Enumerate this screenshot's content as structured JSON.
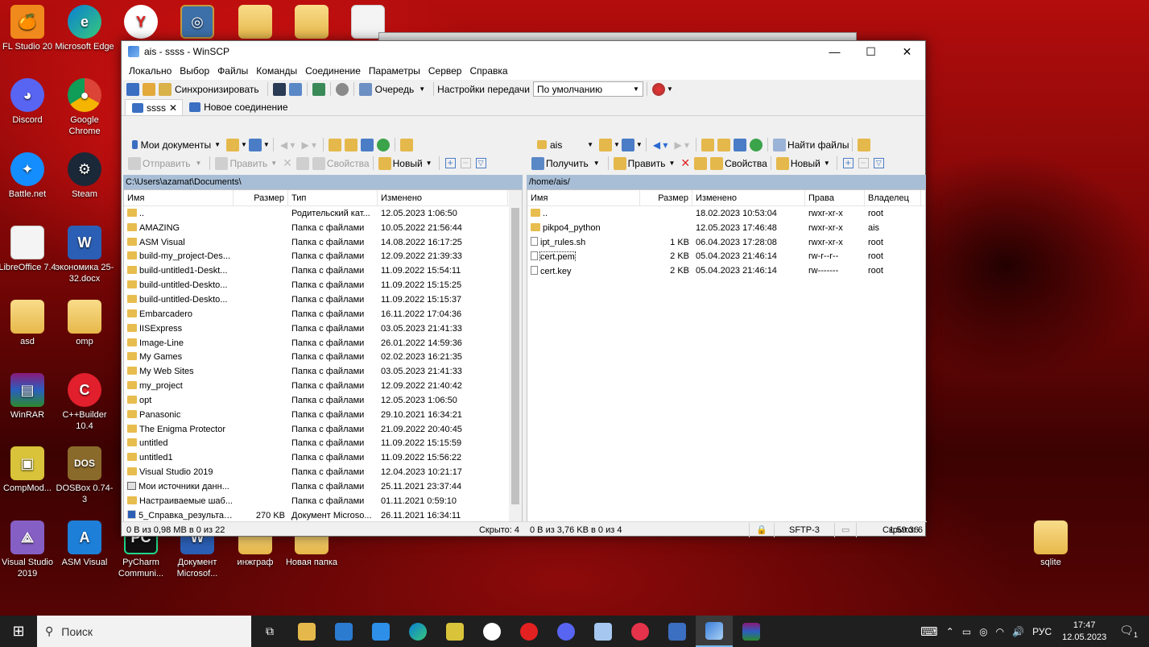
{
  "desktop": {
    "icons": [
      {
        "label": "FL Studio 20",
        "kind": "fl"
      },
      {
        "label": "Microsoft Edge",
        "kind": "edge"
      },
      {
        "label": "Discord",
        "kind": "discord"
      },
      {
        "label": "Google Chrome",
        "kind": "chrome"
      },
      {
        "label": "Battle.net",
        "kind": "battle"
      },
      {
        "label": "Steam",
        "kind": "steam"
      },
      {
        "label": "LibreOffice 7.4",
        "kind": "doc"
      },
      {
        "label": "экономика 25-32.docx",
        "kind": "word"
      },
      {
        "label": "asd",
        "kind": "folder"
      },
      {
        "label": "omp",
        "kind": "folder"
      },
      {
        "label": "WinRAR",
        "kind": "winrar"
      },
      {
        "label": "C++Builder 10.4",
        "kind": "cpp"
      },
      {
        "label": "CompMod...",
        "kind": "comp"
      },
      {
        "label": "DOSBox 0.74-3",
        "kind": "dosbox"
      },
      {
        "label": "Visual Studio 2019",
        "kind": "vs"
      },
      {
        "label": "ASM Visual",
        "kind": "asm"
      },
      {
        "label": "PyCharm Communi...",
        "kind": "pycharm"
      },
      {
        "label": "Документ Microsof...",
        "kind": "word"
      },
      {
        "label": "инжграф",
        "kind": "folder"
      },
      {
        "label": "Новая папка",
        "kind": "folder"
      },
      {
        "label": "sqlite",
        "kind": "folder"
      }
    ]
  },
  "window": {
    "title": "ais - ssss - WinSCP",
    "controls": {
      "minimize": "—",
      "maximize": "☐",
      "close": "✕"
    },
    "menu": [
      "Локально",
      "Выбор",
      "Файлы",
      "Команды",
      "Соединение",
      "Параметры",
      "Сервер",
      "Справка"
    ],
    "toolbar": {
      "sync": "Синхронизировать",
      "queue": "Очередь",
      "transfer_label": "Настройки передачи",
      "transfer_value": "По умолчанию"
    },
    "tabs": [
      {
        "label": "ssss",
        "close": "✕"
      },
      {
        "label": "Новое соединение"
      }
    ]
  },
  "left": {
    "location": "Мои документы",
    "actions": {
      "send": "Отправить",
      "edit": "Править",
      "props": "Свойства",
      "new": "Новый"
    },
    "path": "C:\\Users\\azamat\\Documents\\",
    "columns": [
      "Имя",
      "Размер",
      "Тип",
      "Изменено"
    ],
    "rows": [
      {
        "name": "..",
        "size": "",
        "type": "Родительский кат...",
        "mod": "12.05.2023  1:06:50",
        "icon": "up"
      },
      {
        "name": "AMAZING",
        "size": "",
        "type": "Папка с файлами",
        "mod": "10.05.2022  21:56:44",
        "icon": "dir"
      },
      {
        "name": "ASM Visual",
        "size": "",
        "type": "Папка с файлами",
        "mod": "14.08.2022  16:17:25",
        "icon": "dir"
      },
      {
        "name": "build-my_project-Des...",
        "size": "",
        "type": "Папка с файлами",
        "mod": "12.09.2022  21:39:33",
        "icon": "dir"
      },
      {
        "name": "build-untitled1-Deskt...",
        "size": "",
        "type": "Папка с файлами",
        "mod": "11.09.2022  15:54:11",
        "icon": "dir"
      },
      {
        "name": "build-untitled-Deskto...",
        "size": "",
        "type": "Папка с файлами",
        "mod": "11.09.2022  15:15:25",
        "icon": "dir"
      },
      {
        "name": "build-untitled-Deskto...",
        "size": "",
        "type": "Папка с файлами",
        "mod": "11.09.2022  15:15:37",
        "icon": "dir"
      },
      {
        "name": "Embarcadero",
        "size": "",
        "type": "Папка с файлами",
        "mod": "16.11.2022  17:04:36",
        "icon": "dir"
      },
      {
        "name": "IISExpress",
        "size": "",
        "type": "Папка с файлами",
        "mod": "03.05.2023  21:41:33",
        "icon": "dir"
      },
      {
        "name": "Image-Line",
        "size": "",
        "type": "Папка с файлами",
        "mod": "26.01.2022  14:59:36",
        "icon": "dir"
      },
      {
        "name": "My Games",
        "size": "",
        "type": "Папка с файлами",
        "mod": "02.02.2023  16:21:35",
        "icon": "dir"
      },
      {
        "name": "My Web Sites",
        "size": "",
        "type": "Папка с файлами",
        "mod": "03.05.2023  21:41:33",
        "icon": "dir"
      },
      {
        "name": "my_project",
        "size": "",
        "type": "Папка с файлами",
        "mod": "12.09.2022  21:40:42",
        "icon": "dir"
      },
      {
        "name": "opt",
        "size": "",
        "type": "Папка с файлами",
        "mod": "12.05.2023  1:06:50",
        "icon": "dir"
      },
      {
        "name": "Panasonic",
        "size": "",
        "type": "Папка с файлами",
        "mod": "29.10.2021  16:34:21",
        "icon": "dir"
      },
      {
        "name": "The Enigma Protector",
        "size": "",
        "type": "Папка с файлами",
        "mod": "21.09.2022  20:40:45",
        "icon": "dir"
      },
      {
        "name": "untitled",
        "size": "",
        "type": "Папка с файлами",
        "mod": "11.09.2022  15:15:59",
        "icon": "dir"
      },
      {
        "name": "untitled1",
        "size": "",
        "type": "Папка с файлами",
        "mod": "11.09.2022  15:56:22",
        "icon": "dir"
      },
      {
        "name": "Visual Studio 2019",
        "size": "",
        "type": "Папка с файлами",
        "mod": "12.04.2023  10:21:17",
        "icon": "dir"
      },
      {
        "name": "Мои источники данн...",
        "size": "",
        "type": "Папка с файлами",
        "mod": "25.11.2021  23:37:44",
        "icon": "lnk"
      },
      {
        "name": "Настраиваемые шаб...",
        "size": "",
        "type": "Папка с файлами",
        "mod": "01.11.2021  0:59:10",
        "icon": "dir"
      },
      {
        "name": "5_Справка_результат...",
        "size": "270 KB",
        "type": "Документ Microso...",
        "mod": "26.11.2021  16:34:11",
        "icon": "doc"
      }
    ],
    "status_left": "0 B из 0,98 MB в 0 из 22",
    "status_right": "Скрыто: 4"
  },
  "right": {
    "location": "ais",
    "find": "Найти файлы",
    "actions": {
      "get": "Получить",
      "edit": "Править",
      "props": "Свойства",
      "new": "Новый"
    },
    "path": "/home/ais/",
    "columns": [
      "Имя",
      "Размер",
      "Изменено",
      "Права",
      "Владелец"
    ],
    "rows": [
      {
        "name": "..",
        "size": "",
        "mod": "18.02.2023 10:53:04",
        "rights": "rwxr-xr-x",
        "owner": "root",
        "icon": "up"
      },
      {
        "name": "pikpo4_python",
        "size": "",
        "mod": "12.05.2023 17:46:48",
        "rights": "rwxr-xr-x",
        "owner": "ais",
        "icon": "dir"
      },
      {
        "name": "ipt_rules.sh",
        "size": "1 KB",
        "mod": "06.04.2023 17:28:08",
        "rights": "rwxr-xr-x",
        "owner": "root",
        "icon": "file"
      },
      {
        "name": "cert.pem",
        "size": "2 KB",
        "mod": "05.04.2023 21:46:14",
        "rights": "rw-r--r--",
        "owner": "root",
        "icon": "file"
      },
      {
        "name": "cert.key",
        "size": "2 KB",
        "mod": "05.04.2023 21:46:14",
        "rights": "rw-------",
        "owner": "root",
        "icon": "file"
      }
    ],
    "status_left": "0 B из 3,76 KB в 0 из 4",
    "status_right": "Скрыто: 6"
  },
  "bottom_status": {
    "protocol": "SFTP-3",
    "time": "1:59:36"
  },
  "taskbar": {
    "search_placeholder": "Поиск",
    "lang": "РУС",
    "time": "17:47",
    "date": "12.05.2023",
    "notif_count": "1"
  }
}
